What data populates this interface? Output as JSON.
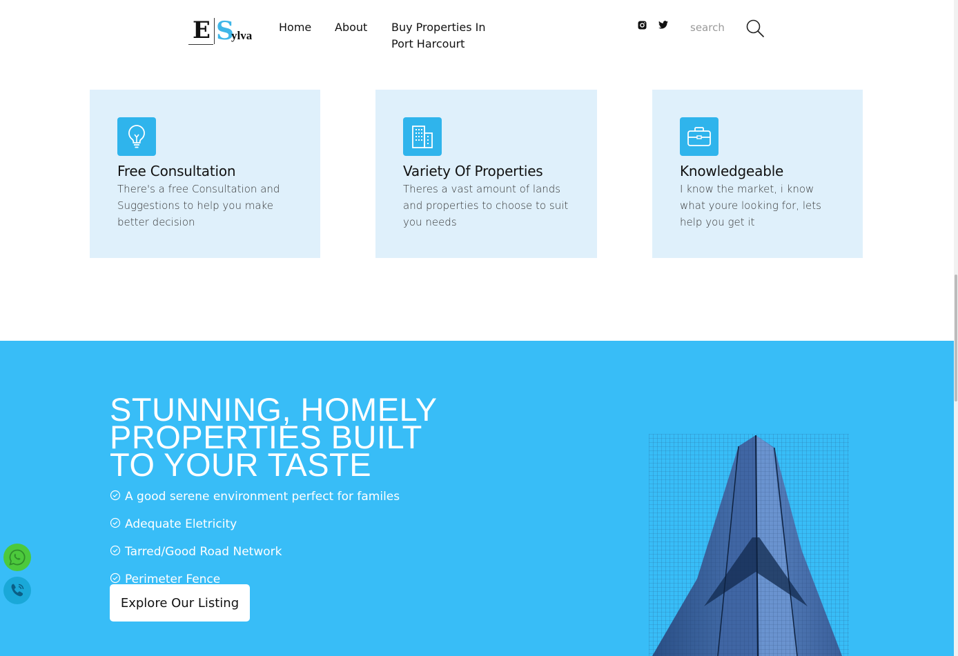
{
  "header": {
    "logo": {
      "letter_e": "E",
      "letter_s": "S",
      "rest": "ylva"
    },
    "nav": [
      {
        "label": "Home"
      },
      {
        "label": "About"
      },
      {
        "label": "Buy Properties In Port Harcourt"
      }
    ],
    "social_icons": [
      "instagram-icon",
      "twitter-icon"
    ],
    "search": {
      "placeholder": "search",
      "value": ""
    }
  },
  "features": [
    {
      "icon": "lightbulb-icon",
      "title": "Free Consultation",
      "text": "There's a free Consultation and Suggestions to help you make better decision"
    },
    {
      "icon": "building-icon",
      "title": "Variety Of Properties",
      "text": "Theres a vast amount of lands and properties to choose to suit you needs"
    },
    {
      "icon": "briefcase-icon",
      "title": "Knowledgeable",
      "text": "I know the market, i know what youre looking for, lets help you get it"
    }
  ],
  "hero": {
    "title": "STUNNING, HOMELY PROPERTIES BUILT TO YOUR TASTE",
    "bullets": [
      "A good serene environment perfect for familes",
      "Adequate Eletricity",
      "Tarred/Good Road Network",
      "Perimeter Fence"
    ],
    "cta_label": "Explore Our Listing"
  },
  "floating": [
    "whatsapp-icon",
    "phone-icon"
  ],
  "colors": {
    "accent": "#38bdf7",
    "card_bg": "#dff0fb",
    "icon_bg": "#2fb4ec",
    "whatsapp": "#4cc93c"
  }
}
